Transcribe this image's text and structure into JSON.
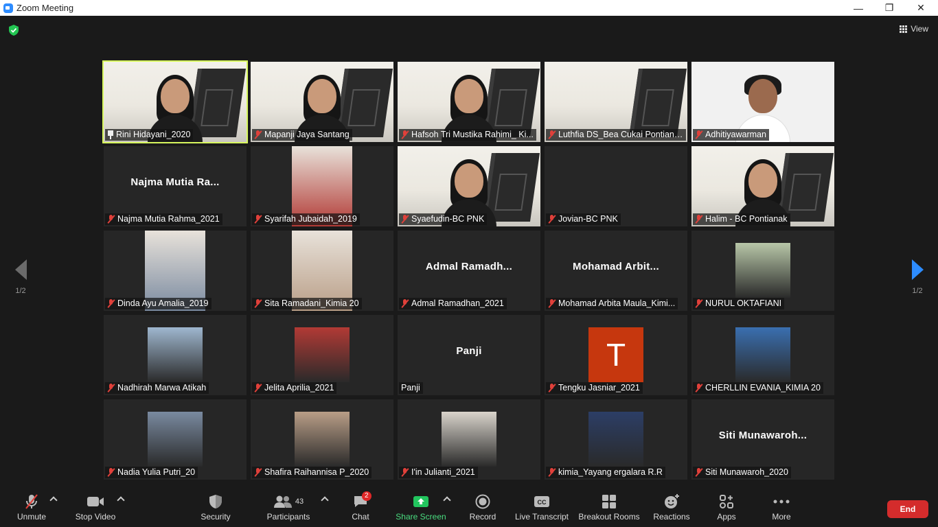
{
  "window": {
    "title": "Zoom Meeting",
    "minimize": "—",
    "restore": "❐",
    "close": "✕"
  },
  "top": {
    "view_label": "View"
  },
  "pager": {
    "left": "1/2",
    "right": "1/2"
  },
  "tiles": [
    {
      "name": "Rini Hidayani_2020",
      "kind": "banner-person",
      "icon": "pin-icon",
      "active": true
    },
    {
      "name": "Mapanji Jaya Santang",
      "kind": "banner-person"
    },
    {
      "name": "Hafsoh Tri Mustika Rahimi_ Ki...",
      "kind": "banner-person"
    },
    {
      "name": "Luthfia DS_Bea Cukai Pontianak",
      "kind": "banner"
    },
    {
      "name": "Adhitiyawarman",
      "kind": "person-white"
    },
    {
      "name": "Najma Mutia Rahma_2021",
      "kind": "name",
      "bigname": "Najma  Mutia  Ra..."
    },
    {
      "name": "Syarifah Jubaidah_2019",
      "kind": "photo-tall"
    },
    {
      "name": "Syaefudin-BC PNK",
      "kind": "banner-person"
    },
    {
      "name": "Jovian-BC PNK",
      "kind": "blank"
    },
    {
      "name": "Halim - BC Pontianak",
      "kind": "banner-person"
    },
    {
      "name": "Dinda Ayu Amalia_2019",
      "kind": "photo-tall"
    },
    {
      "name": "Sita Ramadani_Kimia 20",
      "kind": "photo-tall"
    },
    {
      "name": "Admal Ramadhan_2021",
      "kind": "name",
      "bigname": "Admal  Ramadh..."
    },
    {
      "name": "Mohamad Arbita Maula_Kimi...",
      "kind": "name",
      "bigname": "Mohamad  Arbit..."
    },
    {
      "name": "NURUL OKTAFIANI",
      "kind": "photo"
    },
    {
      "name": "Nadhirah Marwa Atikah",
      "kind": "photo"
    },
    {
      "name": "Jelita Aprilia_2021",
      "kind": "photo"
    },
    {
      "name": "Panji",
      "kind": "name",
      "bigname": "Panji",
      "unmuted": true
    },
    {
      "name": "Tengku Jasniar_2021",
      "kind": "avatar",
      "initial": "T"
    },
    {
      "name": "CHERLLIN EVANIA_KIMIA 20",
      "kind": "photo"
    },
    {
      "name": "Nadia Yulia Putri_20",
      "kind": "photo"
    },
    {
      "name": "Shafira Raihannisa P_2020",
      "kind": "photo"
    },
    {
      "name": "I'in Julianti_2021",
      "kind": "photo"
    },
    {
      "name": "kimia_Yayang ergalara R.R",
      "kind": "photo"
    },
    {
      "name": "Siti Munawaroh_2020",
      "kind": "name",
      "bigname": "Siti  Munawaroh..."
    }
  ],
  "toolbar": {
    "unmute": "Unmute",
    "stop_video": "Stop Video",
    "security": "Security",
    "participants": "Participants",
    "participants_count": "43",
    "chat": "Chat",
    "chat_badge": "2",
    "share_screen": "Share Screen",
    "record": "Record",
    "live_transcript": "Live Transcript",
    "breakout_rooms": "Breakout Rooms",
    "reactions": "Reactions",
    "apps": "Apps",
    "more": "More",
    "end": "End"
  },
  "colors": {
    "active_speaker": "#d8f85e",
    "share_green": "#22c55e",
    "end_red": "#d42c2c",
    "accent_blue": "#2d8cff"
  }
}
